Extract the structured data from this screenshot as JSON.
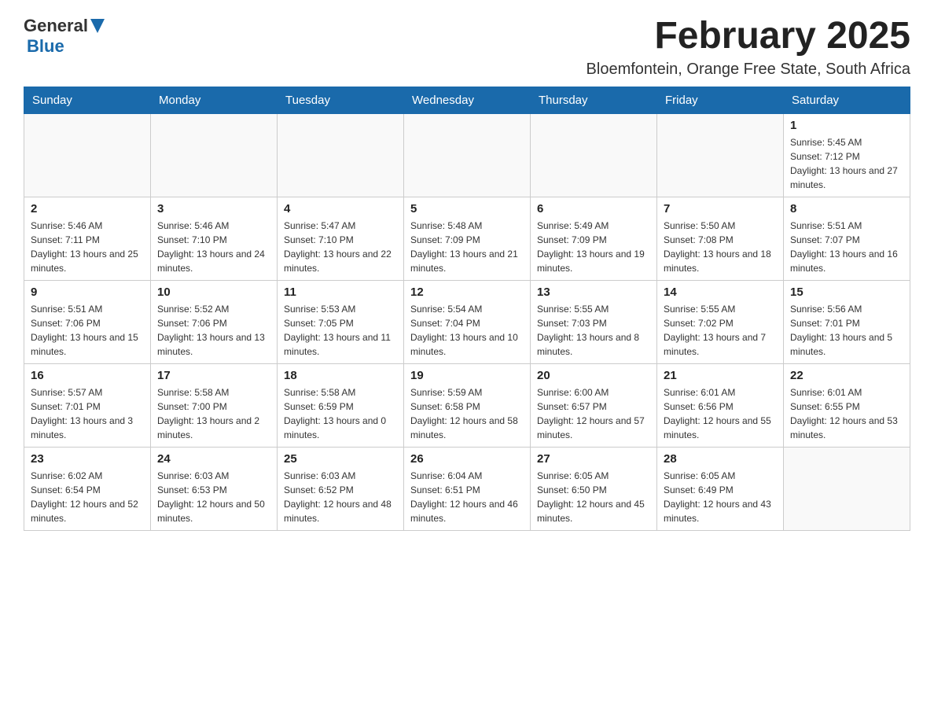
{
  "header": {
    "logo_general": "General",
    "logo_blue": "Blue",
    "month_title": "February 2025",
    "subtitle": "Bloemfontein, Orange Free State, South Africa"
  },
  "days_of_week": [
    "Sunday",
    "Monday",
    "Tuesday",
    "Wednesday",
    "Thursday",
    "Friday",
    "Saturday"
  ],
  "weeks": [
    [
      {
        "day": "",
        "info": ""
      },
      {
        "day": "",
        "info": ""
      },
      {
        "day": "",
        "info": ""
      },
      {
        "day": "",
        "info": ""
      },
      {
        "day": "",
        "info": ""
      },
      {
        "day": "",
        "info": ""
      },
      {
        "day": "1",
        "info": "Sunrise: 5:45 AM\nSunset: 7:12 PM\nDaylight: 13 hours and 27 minutes."
      }
    ],
    [
      {
        "day": "2",
        "info": "Sunrise: 5:46 AM\nSunset: 7:11 PM\nDaylight: 13 hours and 25 minutes."
      },
      {
        "day": "3",
        "info": "Sunrise: 5:46 AM\nSunset: 7:10 PM\nDaylight: 13 hours and 24 minutes."
      },
      {
        "day": "4",
        "info": "Sunrise: 5:47 AM\nSunset: 7:10 PM\nDaylight: 13 hours and 22 minutes."
      },
      {
        "day": "5",
        "info": "Sunrise: 5:48 AM\nSunset: 7:09 PM\nDaylight: 13 hours and 21 minutes."
      },
      {
        "day": "6",
        "info": "Sunrise: 5:49 AM\nSunset: 7:09 PM\nDaylight: 13 hours and 19 minutes."
      },
      {
        "day": "7",
        "info": "Sunrise: 5:50 AM\nSunset: 7:08 PM\nDaylight: 13 hours and 18 minutes."
      },
      {
        "day": "8",
        "info": "Sunrise: 5:51 AM\nSunset: 7:07 PM\nDaylight: 13 hours and 16 minutes."
      }
    ],
    [
      {
        "day": "9",
        "info": "Sunrise: 5:51 AM\nSunset: 7:06 PM\nDaylight: 13 hours and 15 minutes."
      },
      {
        "day": "10",
        "info": "Sunrise: 5:52 AM\nSunset: 7:06 PM\nDaylight: 13 hours and 13 minutes."
      },
      {
        "day": "11",
        "info": "Sunrise: 5:53 AM\nSunset: 7:05 PM\nDaylight: 13 hours and 11 minutes."
      },
      {
        "day": "12",
        "info": "Sunrise: 5:54 AM\nSunset: 7:04 PM\nDaylight: 13 hours and 10 minutes."
      },
      {
        "day": "13",
        "info": "Sunrise: 5:55 AM\nSunset: 7:03 PM\nDaylight: 13 hours and 8 minutes."
      },
      {
        "day": "14",
        "info": "Sunrise: 5:55 AM\nSunset: 7:02 PM\nDaylight: 13 hours and 7 minutes."
      },
      {
        "day": "15",
        "info": "Sunrise: 5:56 AM\nSunset: 7:01 PM\nDaylight: 13 hours and 5 minutes."
      }
    ],
    [
      {
        "day": "16",
        "info": "Sunrise: 5:57 AM\nSunset: 7:01 PM\nDaylight: 13 hours and 3 minutes."
      },
      {
        "day": "17",
        "info": "Sunrise: 5:58 AM\nSunset: 7:00 PM\nDaylight: 13 hours and 2 minutes."
      },
      {
        "day": "18",
        "info": "Sunrise: 5:58 AM\nSunset: 6:59 PM\nDaylight: 13 hours and 0 minutes."
      },
      {
        "day": "19",
        "info": "Sunrise: 5:59 AM\nSunset: 6:58 PM\nDaylight: 12 hours and 58 minutes."
      },
      {
        "day": "20",
        "info": "Sunrise: 6:00 AM\nSunset: 6:57 PM\nDaylight: 12 hours and 57 minutes."
      },
      {
        "day": "21",
        "info": "Sunrise: 6:01 AM\nSunset: 6:56 PM\nDaylight: 12 hours and 55 minutes."
      },
      {
        "day": "22",
        "info": "Sunrise: 6:01 AM\nSunset: 6:55 PM\nDaylight: 12 hours and 53 minutes."
      }
    ],
    [
      {
        "day": "23",
        "info": "Sunrise: 6:02 AM\nSunset: 6:54 PM\nDaylight: 12 hours and 52 minutes."
      },
      {
        "day": "24",
        "info": "Sunrise: 6:03 AM\nSunset: 6:53 PM\nDaylight: 12 hours and 50 minutes."
      },
      {
        "day": "25",
        "info": "Sunrise: 6:03 AM\nSunset: 6:52 PM\nDaylight: 12 hours and 48 minutes."
      },
      {
        "day": "26",
        "info": "Sunrise: 6:04 AM\nSunset: 6:51 PM\nDaylight: 12 hours and 46 minutes."
      },
      {
        "day": "27",
        "info": "Sunrise: 6:05 AM\nSunset: 6:50 PM\nDaylight: 12 hours and 45 minutes."
      },
      {
        "day": "28",
        "info": "Sunrise: 6:05 AM\nSunset: 6:49 PM\nDaylight: 12 hours and 43 minutes."
      },
      {
        "day": "",
        "info": ""
      }
    ]
  ]
}
